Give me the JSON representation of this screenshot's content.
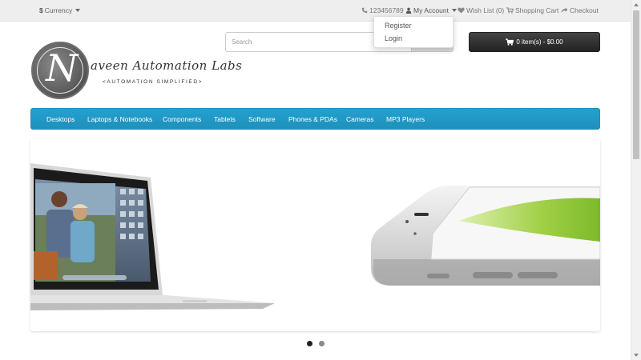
{
  "topbar": {
    "currency_symbol": "$",
    "currency_label": "Currency",
    "phone_icon": "phone-icon",
    "phone": "123456789",
    "account_icon": "user-icon",
    "account_label": "My Account",
    "wishlist_icon": "heart-icon",
    "wishlist_label": "Wish List (0)",
    "cart_icon": "cart-icon",
    "cart_label": "Shopping Cart",
    "checkout_icon": "share-icon",
    "checkout_label": "Checkout"
  },
  "account_menu": {
    "items": [
      "Register",
      "Login"
    ]
  },
  "logo": {
    "letter": "N",
    "name": "aveen Automation Labs",
    "tagline": "<AUTOMATION SIMPLIFIED>"
  },
  "search": {
    "placeholder": "Search",
    "value": ""
  },
  "cart_button": {
    "icon": "cart-icon",
    "label": "0 item(s) - $0.00"
  },
  "nav": {
    "items": [
      "Desktops",
      "Laptops & Notebooks",
      "Components",
      "Tablets",
      "Software",
      "Phones & PDAs",
      "Cameras",
      "MP3 Players"
    ]
  },
  "slider": {
    "active_slide": 1,
    "slide_count": 2
  },
  "colors": {
    "nav_blue": "#229ac8",
    "cart_dark": "#303030",
    "topbar_bg": "#eeeeee"
  }
}
